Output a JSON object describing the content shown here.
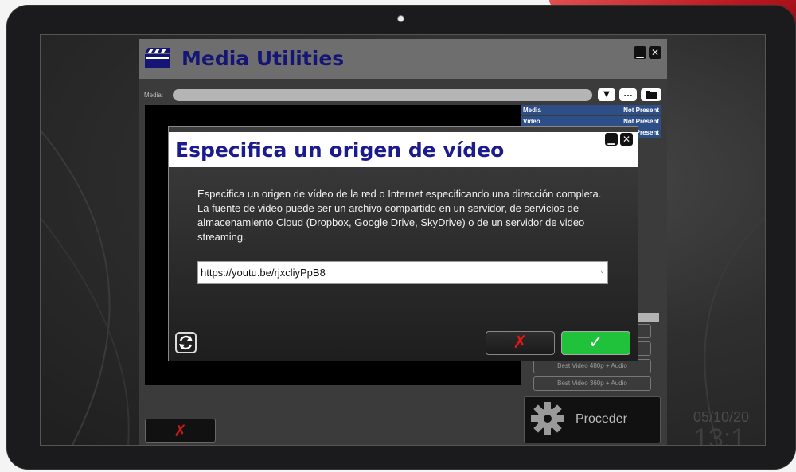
{
  "app": {
    "title": "Media Utilities",
    "media_label": "Media:",
    "media_value": "",
    "buttons": {
      "dropdown": "▼",
      "browse": "...",
      "folder": "📂"
    }
  },
  "info_table": [
    {
      "key": "Media",
      "value": "Not Present"
    },
    {
      "key": "Video",
      "value": "Not Present"
    },
    {
      "key": "",
      "value": "Present"
    }
  ],
  "quality_options": [
    {
      "label": ""
    },
    {
      "label": ""
    },
    {
      "label": "Best Video 480p + Audio"
    },
    {
      "label": "Best Video 360p + Audio"
    }
  ],
  "proceed_label": "Proceder",
  "cancel_symbol": "✗",
  "clock": {
    "date": "05/10/20",
    "time": "13:1"
  },
  "dialog": {
    "title": "Especifica un origen de vídeo",
    "description_1": "Especifica un origen de vídeo de la red o Internet especificando una dirección completa.",
    "description_2": "La fuente de video puede ser un archivo compartido en un servidor, de servicios de almacenamiento Cloud (Dropbox, Google Drive, SkyDrive) o de un servidor de video streaming.",
    "url_value": "https://youtu.be/rjxcliyPpB8",
    "cancel_symbol": "✗",
    "ok_symbol": "✓"
  },
  "colors": {
    "title_blue": "#1b1b8f",
    "info_blue": "#2d4e86",
    "ok_green": "#1fc23a",
    "cancel_red": "#e01818",
    "accent_red": "#b81620"
  },
  "icons": [
    "clapperboard-icon",
    "minimize-icon",
    "close-icon",
    "folder-icon",
    "gear-icon",
    "refresh-icon",
    "check-icon",
    "cross-icon"
  ]
}
